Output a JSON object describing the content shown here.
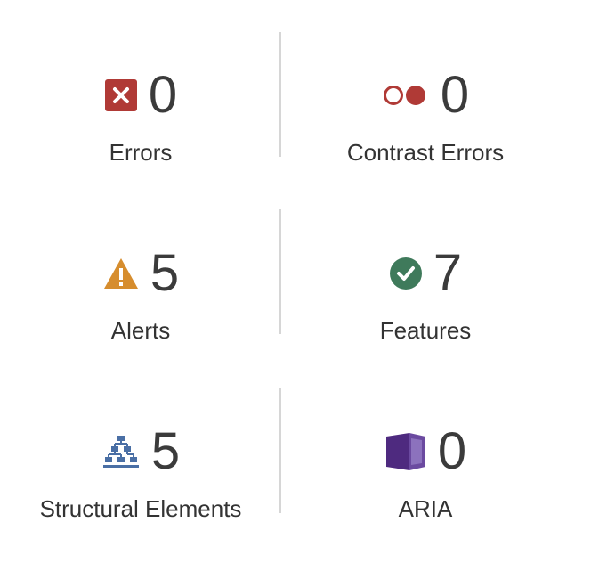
{
  "summary": {
    "errors": {
      "count": "0",
      "label": "Errors",
      "icon": "error-x-icon",
      "color": "#b03a36"
    },
    "contrast_errors": {
      "count": "0",
      "label": "Contrast Errors",
      "icon": "contrast-circles-icon",
      "color": "#b03a36"
    },
    "alerts": {
      "count": "5",
      "label": "Alerts",
      "icon": "warning-triangle-icon",
      "color": "#d68d2e"
    },
    "features": {
      "count": "7",
      "label": "Features",
      "icon": "check-circle-icon",
      "color": "#3f7a5b"
    },
    "structural_elements": {
      "count": "5",
      "label": "Structural Elements",
      "icon": "hierarchy-tree-icon",
      "color": "#4a6fa5"
    },
    "aria": {
      "count": "0",
      "label": "ARIA",
      "icon": "aria-box-icon",
      "color": "#4e2a7f"
    }
  }
}
